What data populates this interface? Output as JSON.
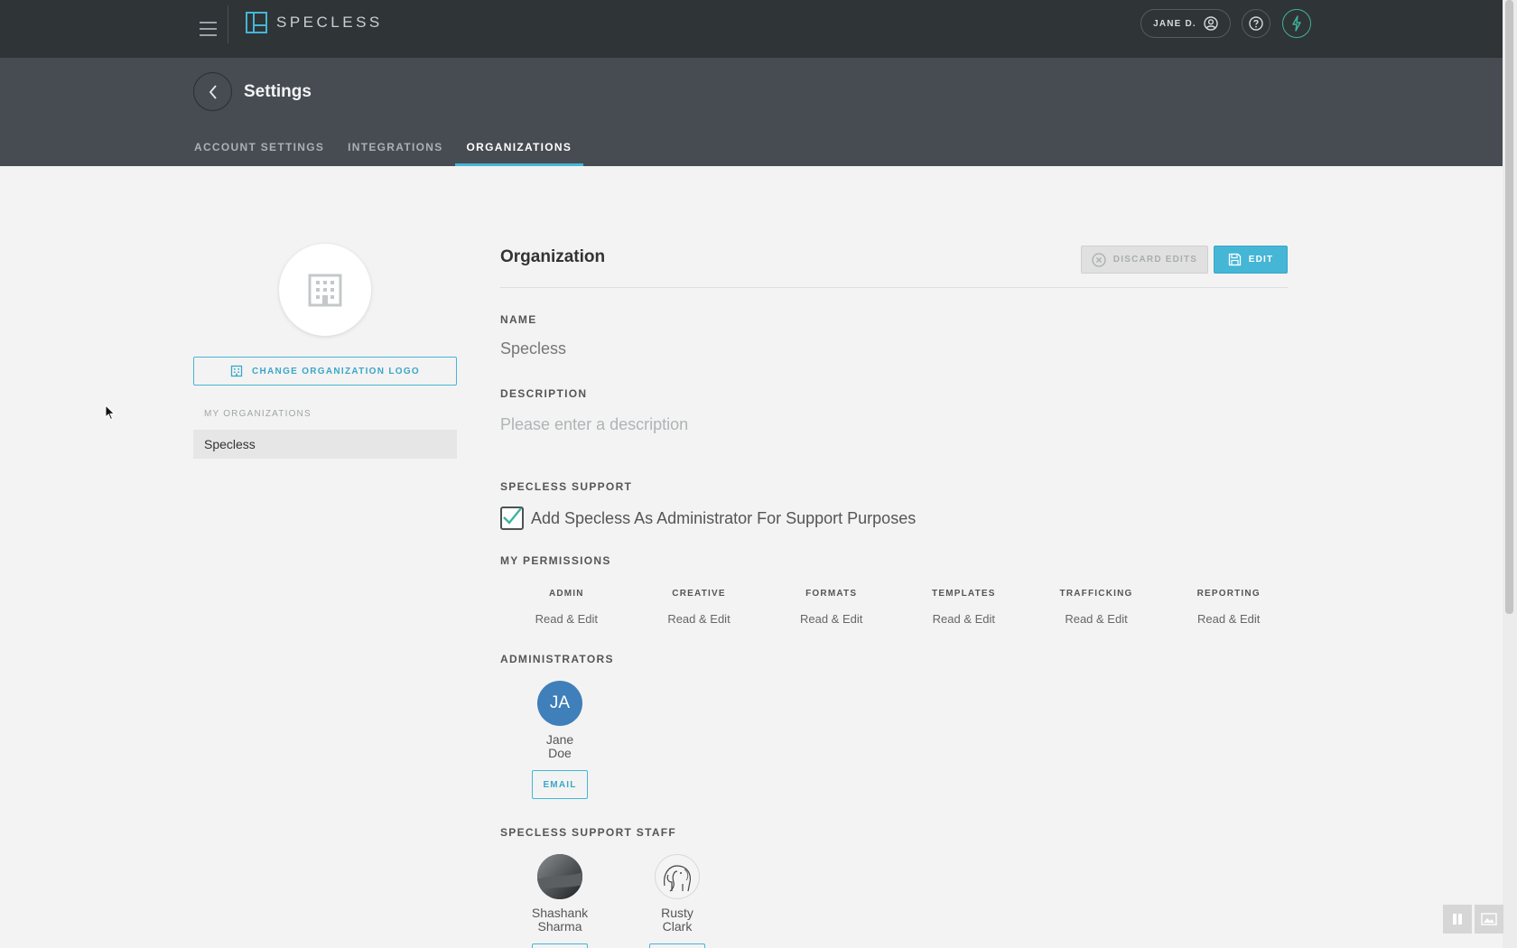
{
  "app": {
    "brand": "SPECLESS",
    "user_label": "JANE D."
  },
  "header": {
    "title": "Settings",
    "tabs": [
      {
        "label": "ACCOUNT SETTINGS",
        "active": false
      },
      {
        "label": "INTEGRATIONS",
        "active": false
      },
      {
        "label": "ORGANIZATIONS",
        "active": true
      }
    ]
  },
  "sidebar": {
    "change_logo_label": "CHANGE ORGANIZATION LOGO",
    "my_orgs_label": "MY ORGANIZATIONS",
    "organizations": [
      "Specless"
    ]
  },
  "organization": {
    "title": "Organization",
    "discard_label": "DISCARD EDITS",
    "edit_label": "EDIT",
    "name_label": "NAME",
    "name_value": "Specless",
    "description_label": "DESCRIPTION",
    "description_placeholder": "Please enter a description",
    "support_label": "SPECLESS SUPPORT",
    "support_checkbox_label": "Add Specless As Administrator For Support Purposes",
    "support_checked": true,
    "permissions_label": "MY PERMISSIONS",
    "permissions": [
      {
        "name": "ADMIN",
        "value": "Read & Edit"
      },
      {
        "name": "CREATIVE",
        "value": "Read & Edit"
      },
      {
        "name": "FORMATS",
        "value": "Read & Edit"
      },
      {
        "name": "TEMPLATES",
        "value": "Read & Edit"
      },
      {
        "name": "TRAFFICKING",
        "value": "Read & Edit"
      },
      {
        "name": "REPORTING",
        "value": "Read & Edit"
      }
    ],
    "administrators_label": "ADMINISTRATORS",
    "administrators": [
      {
        "initials": "JA",
        "first": "Jane",
        "last": "Doe",
        "email_label": "EMAIL"
      }
    ],
    "support_staff_label": "SPECLESS SUPPORT STAFF",
    "support_staff": [
      {
        "first": "Shashank",
        "last": "Sharma"
      },
      {
        "first": "Rusty",
        "last": "Clark"
      }
    ]
  },
  "colors": {
    "accent": "#45b6d6",
    "topbar": "#2f3437",
    "header": "#464c51",
    "avatar_blue": "#3f7fba",
    "bolt_green": "#3fb39b"
  }
}
